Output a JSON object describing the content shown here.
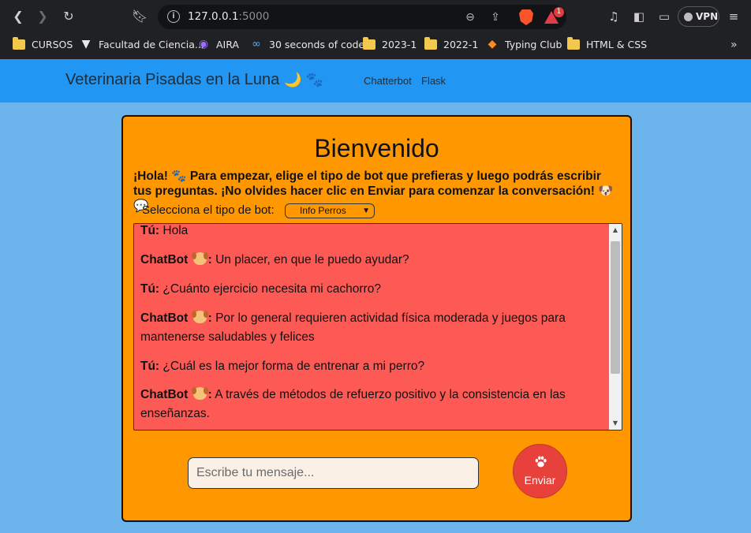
{
  "browser": {
    "url_host": "127.0.0.1",
    "url_port": ":5000",
    "shields_badge": "1",
    "vpn_label": "VPN"
  },
  "bookmarks": [
    {
      "label": "CURSOS",
      "icon": "folder-icon"
    },
    {
      "label": "Facultad de Ciencia...",
      "icon": "faculty-logo-icon"
    },
    {
      "label": "AIRA",
      "icon": "aira-icon"
    },
    {
      "label": "30 seconds of code",
      "icon": "code-icon"
    },
    {
      "label": "2023-1",
      "icon": "folder-icon"
    },
    {
      "label": "2022-1",
      "icon": "folder-icon"
    },
    {
      "label": "Typing Club",
      "icon": "typing-club-icon"
    },
    {
      "label": "HTML & CSS",
      "icon": "folder-icon"
    }
  ],
  "navbar": {
    "brand": "Veterinaria Pisadas en la Luna",
    "brand_emoji": "🌙 🐾",
    "links": [
      "Chatterbot",
      "Flask"
    ]
  },
  "card": {
    "title": "Bienvenido",
    "intro": "¡Hola! 🐾 Para empezar, elige el tipo de bot que prefieras y luego podrás escribir tus preguntas. ¡No olvides hacer clic en Enviar para comenzar la conversación! 🐶 💬",
    "selector_label": "Selecciona el tipo de bot:",
    "selector_value": "Info Perros"
  },
  "chat": {
    "messages": [
      {
        "sender": "Tú:",
        "text": "Hola",
        "bot": false
      },
      {
        "sender": "ChatBot",
        "text": "Un placer, en que le puedo ayudar?",
        "bot": true
      },
      {
        "sender": "Tú:",
        "text": "¿Cuánto ejercicio necesita mi cachorro?",
        "bot": false
      },
      {
        "sender": "ChatBot",
        "text": "Por lo general requieren actividad física moderada y juegos para mantenerse saludables y felices",
        "bot": true
      },
      {
        "sender": "Tú:",
        "text": "¿Cuál es la mejor forma de entrenar a mi perro?",
        "bot": false
      },
      {
        "sender": "ChatBot",
        "text": "A través de métodos de refuerzo positivo y la consistencia en las enseñanzas.",
        "bot": true
      }
    ]
  },
  "input": {
    "placeholder": "Escribe tu mensaje...",
    "send_label": "Enviar"
  },
  "colors": {
    "navbar": "#2196f3",
    "page_bg": "#6cb4ec",
    "card": "#ff9800",
    "chat_bg": "#fd5a56",
    "send_button": "#e8403a"
  }
}
